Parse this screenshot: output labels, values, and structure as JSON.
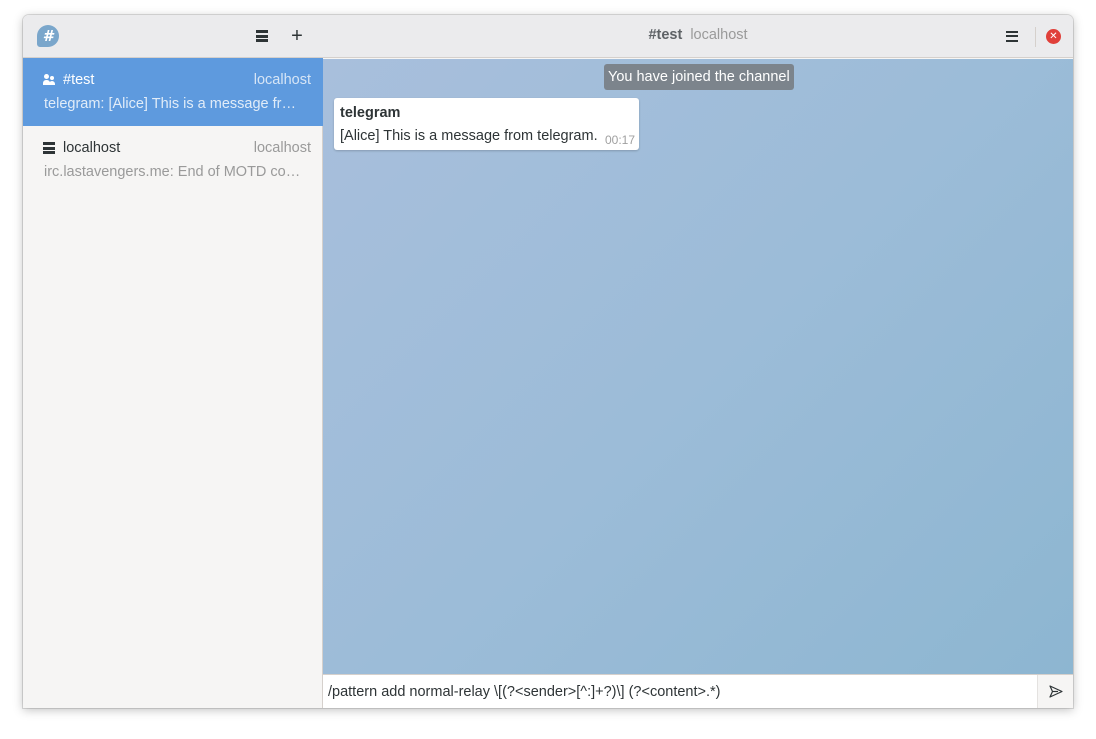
{
  "sidebar": {
    "logo_glyph": "#",
    "chats": [
      {
        "name": "#test",
        "server": "localhost",
        "preview": "telegram: [Alice] This is a message from telegram.",
        "icon": "users-icon",
        "active": true
      },
      {
        "name": "localhost",
        "server": "localhost",
        "preview": "irc.lastavengers.me: End of MOTD command",
        "icon": "server-icon",
        "active": false
      }
    ]
  },
  "main": {
    "title": "#test",
    "subtitle": "localhost",
    "system_message": "You have joined the channel",
    "messages": [
      {
        "sender": "telegram",
        "text": "[Alice] This is a message from telegram.",
        "time": "00:17"
      }
    ],
    "composer": {
      "value": "/pattern add normal-relay \\[(?<sender>[^:]+?)\\] (?<content>.*)"
    }
  },
  "colors": {
    "accent": "#5e9ade",
    "close": "#e0403a"
  }
}
